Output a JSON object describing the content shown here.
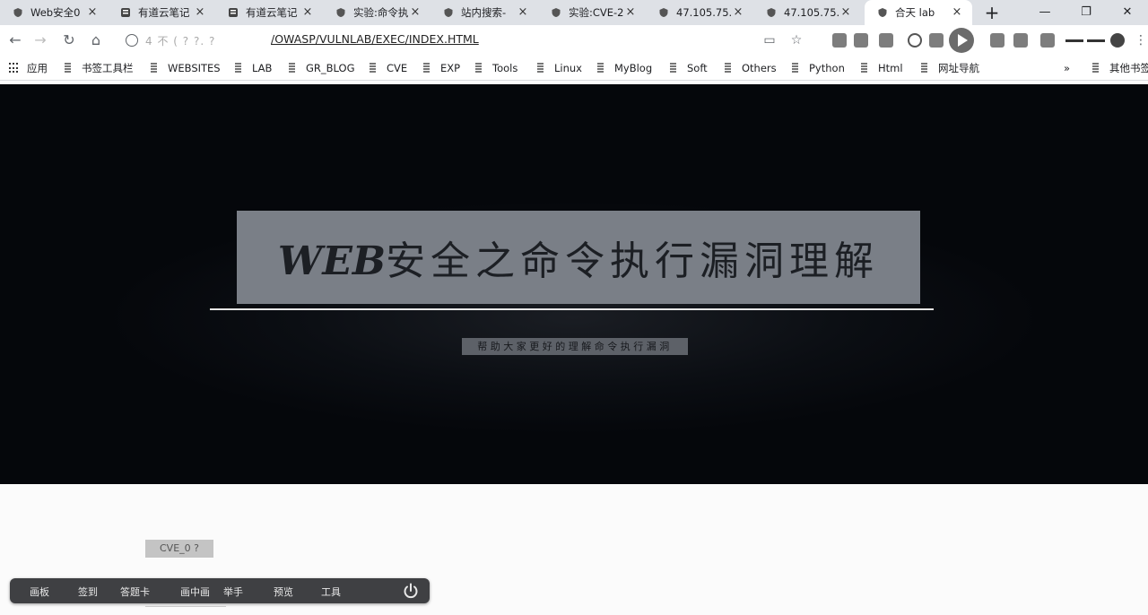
{
  "tabs": [
    {
      "title": "Web安全0",
      "icon": "shield-icon"
    },
    {
      "title": "有道云笔记",
      "icon": "note-icon"
    },
    {
      "title": "有道云笔记",
      "icon": "note-icon"
    },
    {
      "title": "实验:命令执",
      "icon": "shield-icon"
    },
    {
      "title": "站内搜索-",
      "icon": "shield-icon"
    },
    {
      "title": "实验:CVE-2",
      "icon": "shield-icon"
    },
    {
      "title": "47.105.75.",
      "icon": "shield-icon"
    },
    {
      "title": "47.105.75.",
      "icon": "shield-icon"
    },
    {
      "title": "合天 lab",
      "icon": "shield-icon",
      "active": true
    }
  ],
  "address": {
    "host": "4  不  ( ? ?.  ?",
    "path": "/OWASP/VULNLAB/EXEC/INDEX.HTML"
  },
  "bookmarks": [
    {
      "label": "应用",
      "type": "apps"
    },
    {
      "label": "书签工具栏"
    },
    {
      "label": "WEBSITES"
    },
    {
      "label": "LAB"
    },
    {
      "label": "GR_BLOG"
    },
    {
      "label": "CVE"
    },
    {
      "label": "EXP"
    },
    {
      "label": "Tools"
    },
    {
      "label": "Linux"
    },
    {
      "label": "MyBlog"
    },
    {
      "label": "Soft"
    },
    {
      "label": "Others"
    },
    {
      "label": "Python"
    },
    {
      "label": "Html"
    },
    {
      "label": "网址导航"
    },
    {
      "label": "其他书签"
    }
  ],
  "bookmarks_more": "»",
  "hero": {
    "title_web": "WEB",
    "title_rest": "安全之命令执行漏洞理解",
    "subtitle": "帮助大家更好的理解命令执行漏洞"
  },
  "lower": {
    "label": "CVE_0 ?"
  },
  "overlay": {
    "items": [
      "画板",
      "签到",
      "答题卡",
      "画中画",
      "举手",
      "预览",
      "工具"
    ]
  },
  "colors": {
    "hero_bg": "#05070b",
    "title_box": "#7a7f87",
    "overlay_bg": "#3f4043",
    "tabstrip_bg": "#dee1e6"
  }
}
